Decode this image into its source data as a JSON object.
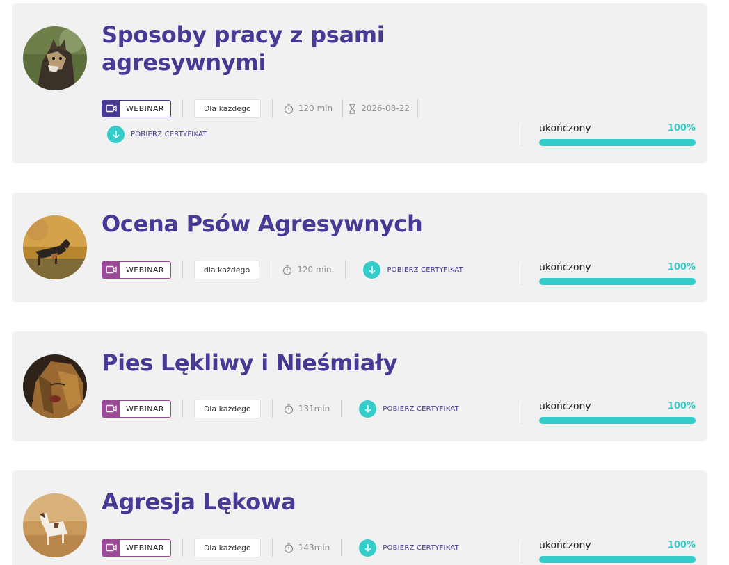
{
  "courses": [
    {
      "title_line1": "Sposoby pracy z psami",
      "title_line2": "agresywnymi",
      "type_label": "WEBINAR",
      "audience": "Dla każdego",
      "duration": "120 min",
      "date": "2026-08-22",
      "cert_label": "POBIERZ CERTYFIKAT",
      "status_label": "ukończony",
      "progress_label": "100%",
      "progress": 1.0
    },
    {
      "title_line1": "Ocena Psów Agresywnych",
      "type_label": "WEBINAR",
      "audience": "dla każdego",
      "duration": "120 min.",
      "cert_label": "POBIERZ CERTYFIKAT",
      "status_label": "ukończony",
      "progress_label": "100%",
      "progress": 1.0
    },
    {
      "title_line1": "Pies Lękliwy i Nieśmiały",
      "type_label": "WEBINAR",
      "audience": "Dla każdego",
      "duration": "131min",
      "cert_label": "POBIERZ CERTYFIKAT",
      "status_label": "ukończony",
      "progress_label": "100%",
      "progress": 1.0
    },
    {
      "title_line1": "Agresja Lękowa",
      "type_label": "WEBINAR",
      "audience": "Dla każdego",
      "duration": "143min",
      "cert_label": "POBIERZ CERTYFIKAT",
      "status_label": "ukończony",
      "progress_label": "100%",
      "progress": 1.0
    }
  ],
  "colors": {
    "brand_purple": "#4a3994",
    "badge_magenta": "#9a4a97",
    "accent_teal": "#33ccc9",
    "card_bg": "#f1f1f2"
  },
  "icons": {
    "type": "video-camera-icon",
    "duration": "stopwatch-icon",
    "date": "hourglass-icon",
    "cert": "download-arrow-icon"
  }
}
